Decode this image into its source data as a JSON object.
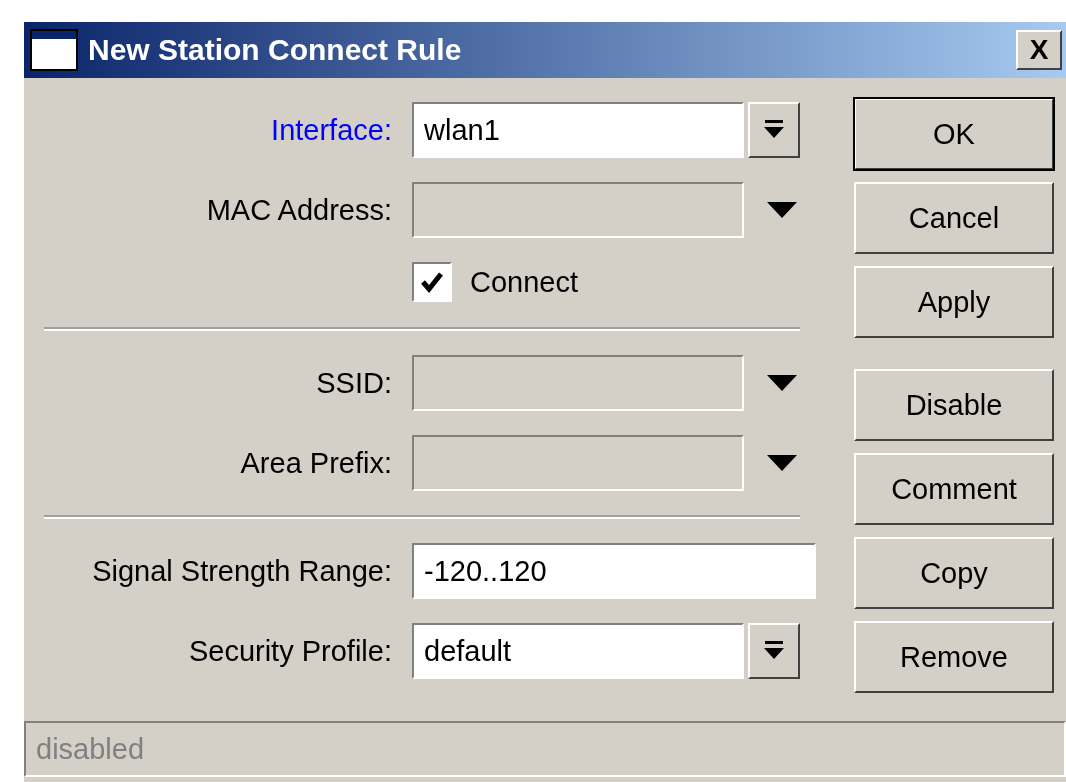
{
  "window": {
    "title": "New Station Connect Rule",
    "close": "X"
  },
  "form": [
    {
      "kind": "dropdown",
      "label": "Interface:",
      "label_highlighted": true,
      "value": "wlan1"
    },
    {
      "kind": "combo",
      "label": "MAC Address:",
      "label_highlighted": false
    },
    {
      "kind": "checkbox",
      "label": "Connect",
      "checked": true
    },
    {
      "kind": "separator"
    },
    {
      "kind": "combo",
      "label": "SSID:",
      "label_highlighted": false
    },
    {
      "kind": "combo",
      "label": "Area Prefix:",
      "label_highlighted": false
    },
    {
      "kind": "separator"
    },
    {
      "kind": "text",
      "label": "Signal Strength Range:",
      "label_highlighted": false,
      "value": "-120..120"
    },
    {
      "kind": "dropdown",
      "label": "Security Profile:",
      "label_highlighted": false,
      "value": "default"
    }
  ],
  "button_groups": [
    [
      {
        "label": "OK",
        "default": true
      },
      {
        "label": "Cancel",
        "default": false
      },
      {
        "label": "Apply",
        "default": false
      }
    ],
    [
      {
        "label": "Disable",
        "default": false
      },
      {
        "label": "Comment",
        "default": false
      },
      {
        "label": "Copy",
        "default": false
      },
      {
        "label": "Remove",
        "default": false
      }
    ]
  ],
  "status_bar": {
    "text": "disabled"
  }
}
